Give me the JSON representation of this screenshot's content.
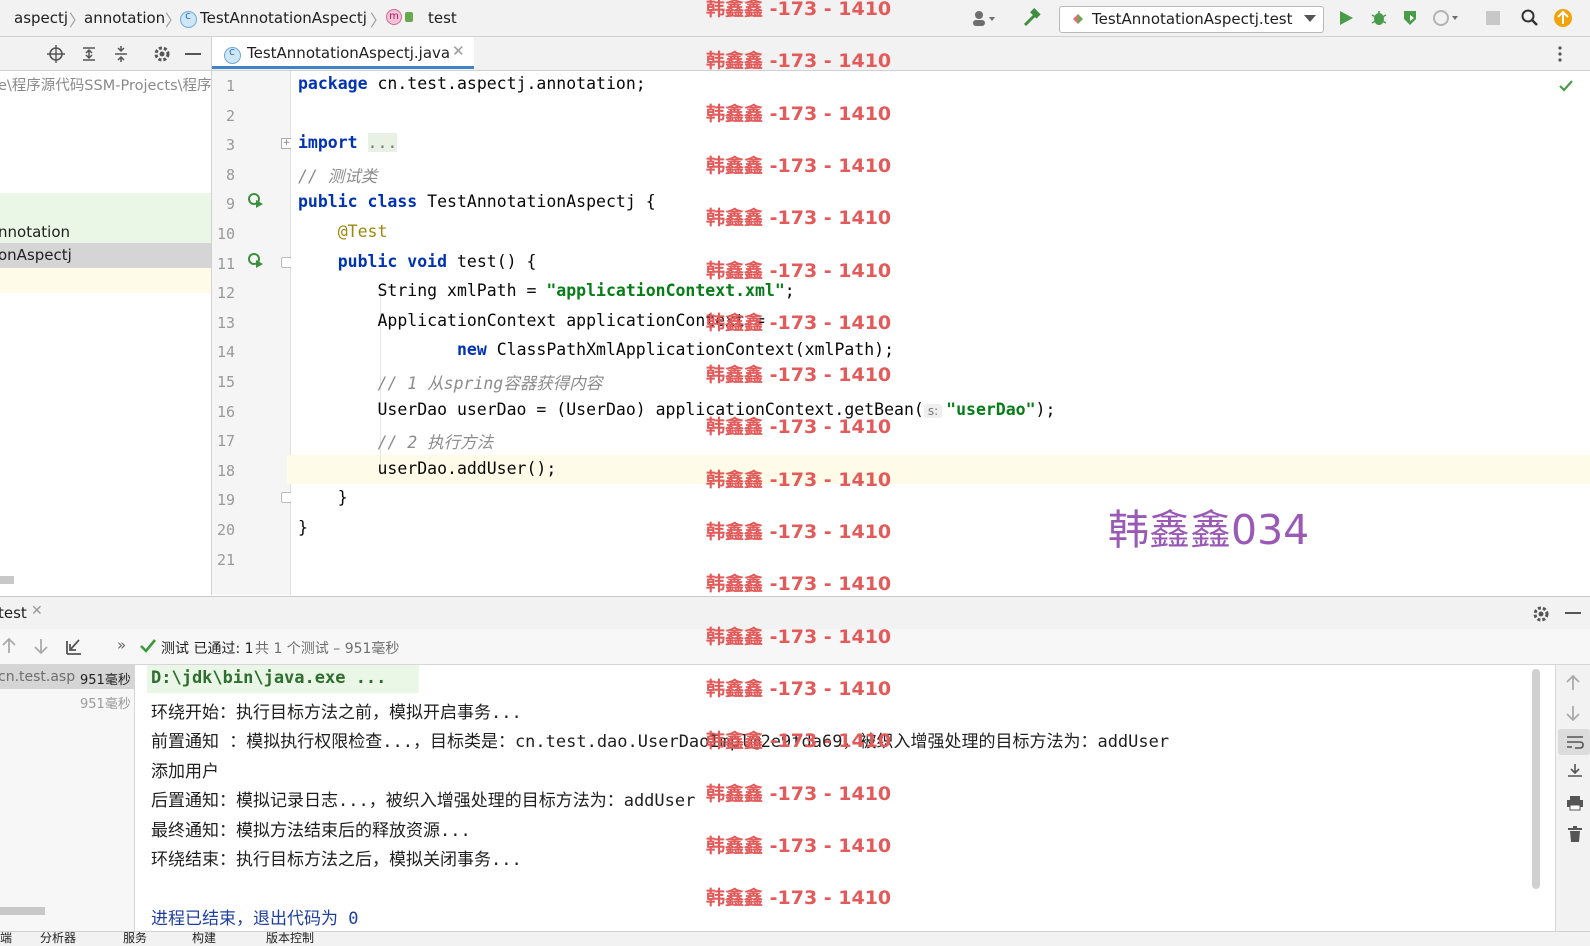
{
  "breadcrumbs": [
    "aspectj",
    "annotation",
    "TestAnnotationAspectj",
    "test"
  ],
  "run_config": "TestAnnotationAspectj.test",
  "editor_tab": "TestAnnotationAspectj.java",
  "project_panel": {
    "path_text": "e\\程序源代码SSM-Projects\\程序",
    "items": [
      "nnotation",
      "onAspectj"
    ]
  },
  "code_lines": [
    {
      "num": "1",
      "text": "package cn.test.aspectj.annotation;"
    },
    {
      "num": "2",
      "text": ""
    },
    {
      "num": "3",
      "text": "import ..."
    },
    {
      "num": "8",
      "text": "// 测试类"
    },
    {
      "num": "9",
      "text": "public class TestAnnotationAspectj {"
    },
    {
      "num": "10",
      "text": "    @Test"
    },
    {
      "num": "11",
      "text": "    public void test() {"
    },
    {
      "num": "12",
      "text": "        String xmlPath = \"applicationContext.xml\";"
    },
    {
      "num": "13",
      "text": "        ApplicationContext applicationContext ="
    },
    {
      "num": "14",
      "text": "                new ClassPathXmlApplicationContext(xmlPath);"
    },
    {
      "num": "15",
      "text": "        // 1 从spring容器获得内容"
    },
    {
      "num": "16",
      "text": "        UserDao userDao = (UserDao) applicationContext.getBean(s: \"userDao\");"
    },
    {
      "num": "17",
      "text": "        // 2 执行方法"
    },
    {
      "num": "18",
      "text": "        userDao.addUser();"
    },
    {
      "num": "19",
      "text": "    }"
    },
    {
      "num": "20",
      "text": "}"
    },
    {
      "num": "21",
      "text": ""
    }
  ],
  "watermark": "韩鑫鑫 -173 - 1410",
  "big_watermark": "韩鑫鑫034",
  "run_panel": {
    "tab_label": "test",
    "status_passed": "测试 已通过: 1",
    "status_detail": "共 1 个测试 – 951毫秒",
    "tree": [
      {
        "label": "cn.test.asp",
        "time": "951毫秒"
      },
      {
        "label": "",
        "time": "951毫秒"
      }
    ],
    "console_lines": [
      "D:\\jdk\\bin\\java.exe ...",
      "环绕开始：执行目标方法之前，模拟开启事务...",
      "前置通知 ：模拟执行权限检查...，目标类是：cn.test.dao.UserDaoImpl@2e9fda69，被织入增强处理的目标方法为：addUser",
      "添加用户",
      "后置通知：模拟记录日志...，被织入增强处理的目标方法为：addUser",
      "最终通知：模拟方法结束后的释放资源...",
      "环绕结束：执行目标方法之后，模拟关闭事务...",
      "",
      "进程已结束，退出代码为 0"
    ]
  },
  "status_bar": [
    "端",
    "分析器",
    "服务",
    "构建",
    "版本控制"
  ],
  "colors": {
    "keyword": "#0033b3",
    "string": "#067d17",
    "comment": "#8c8c8c",
    "annotation": "#9e880d",
    "watermark": "#e25a5a",
    "big_watermark": "#9b59b6",
    "pass": "#3a9a3a"
  }
}
